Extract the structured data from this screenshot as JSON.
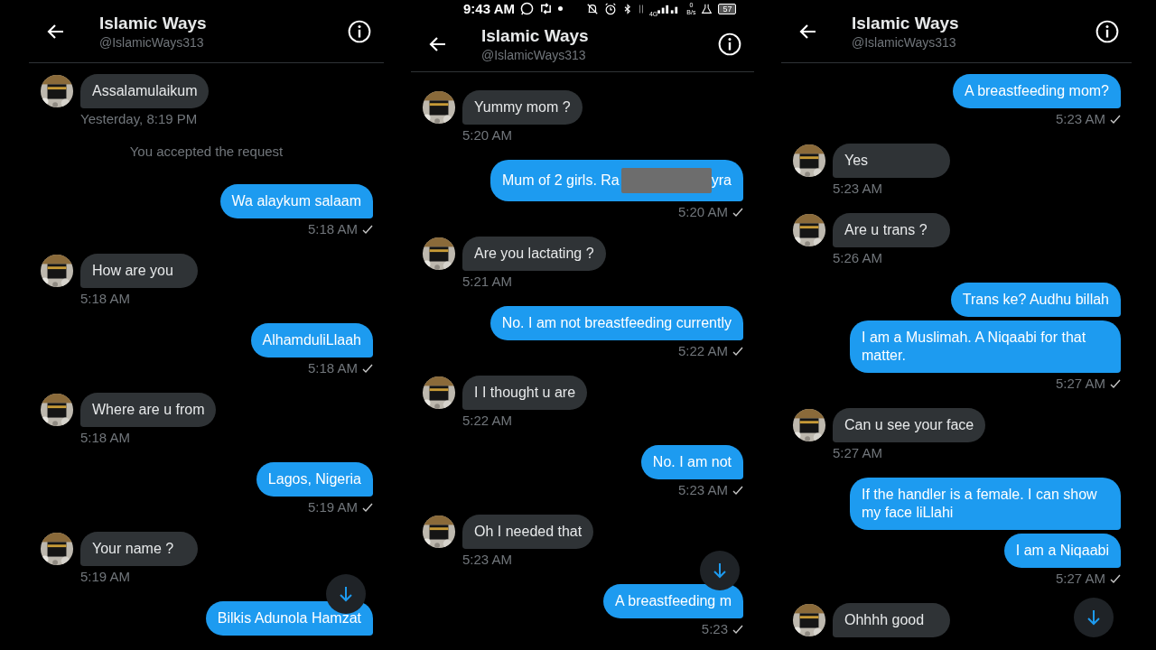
{
  "panels": [
    {
      "header": {
        "title": "Islamic Ways",
        "handle": "@IslamicWays313"
      },
      "messages": [
        {
          "kind": "received",
          "text": "Assalamulaikum",
          "time": "Yesterday, 8:19 PM"
        },
        {
          "kind": "system",
          "text": "You accepted the request"
        },
        {
          "kind": "sent",
          "text": "Wa alaykum salaam",
          "time": "5:18 AM"
        },
        {
          "kind": "received",
          "text": "How are you",
          "time": "5:18 AM"
        },
        {
          "kind": "sent",
          "text": "AlhamduliLlaah",
          "time": "5:18 AM"
        },
        {
          "kind": "received",
          "text": "Where are u from",
          "time": "5:18 AM"
        },
        {
          "kind": "sent",
          "text": "Lagos, Nigeria",
          "time": "5:19 AM"
        },
        {
          "kind": "received",
          "text": "Your name ?",
          "time": "5:19 AM"
        },
        {
          "kind": "sent",
          "text": "Bilkis Adunola Hamzat"
        }
      ]
    },
    {
      "status_bar": {
        "time": "9:43 AM",
        "network": "4G",
        "speed_value": "0",
        "speed_unit": "B/s",
        "battery": "57"
      },
      "header": {
        "title": "Islamic Ways",
        "handle": "@IslamicWays313"
      },
      "messages": [
        {
          "kind": "received",
          "text": "Yummy mom ?",
          "time": "5:20 AM"
        },
        {
          "kind": "sent",
          "text": "Mum of 2 girls. Ra",
          "redacted": true,
          "text_after": "yra",
          "time": "5:20 AM"
        },
        {
          "kind": "received",
          "text": "Are you lactating ?",
          "time": "5:21 AM"
        },
        {
          "kind": "sent",
          "text": "No. I am not breastfeeding currently",
          "time": "5:22 AM"
        },
        {
          "kind": "received",
          "text": "I I thought u are",
          "time": "5:22 AM"
        },
        {
          "kind": "sent",
          "text": "No. I am not",
          "time": "5:23 AM"
        },
        {
          "kind": "received",
          "text": "Oh I needed that",
          "time": "5:23 AM"
        },
        {
          "kind": "sent",
          "text": "A breastfeeding m",
          "time": "5:23"
        }
      ]
    },
    {
      "header": {
        "title": "Islamic Ways",
        "handle": "@IslamicWays313"
      },
      "messages": [
        {
          "kind": "sent",
          "text": "A breastfeeding mom?",
          "time": "5:23 AM"
        },
        {
          "kind": "received",
          "text": "Yes",
          "time": "5:23 AM"
        },
        {
          "kind": "received",
          "text": "Are u trans ?",
          "time": "5:26 AM"
        },
        {
          "kind": "sent",
          "text": "Trans ke? Audhu billah"
        },
        {
          "kind": "sent",
          "text": "I am a Muslimah. A Niqaabi for that matter.",
          "time": "5:27 AM"
        },
        {
          "kind": "received",
          "text": "Can u see your face",
          "time": "5:27 AM"
        },
        {
          "kind": "sent",
          "text": "If the handler is a female. I can show my face liLlahi"
        },
        {
          "kind": "sent",
          "text": "I am a Niqaabi",
          "time": "5:27 AM"
        },
        {
          "kind": "received",
          "text": "Ohhhh good"
        }
      ]
    }
  ]
}
